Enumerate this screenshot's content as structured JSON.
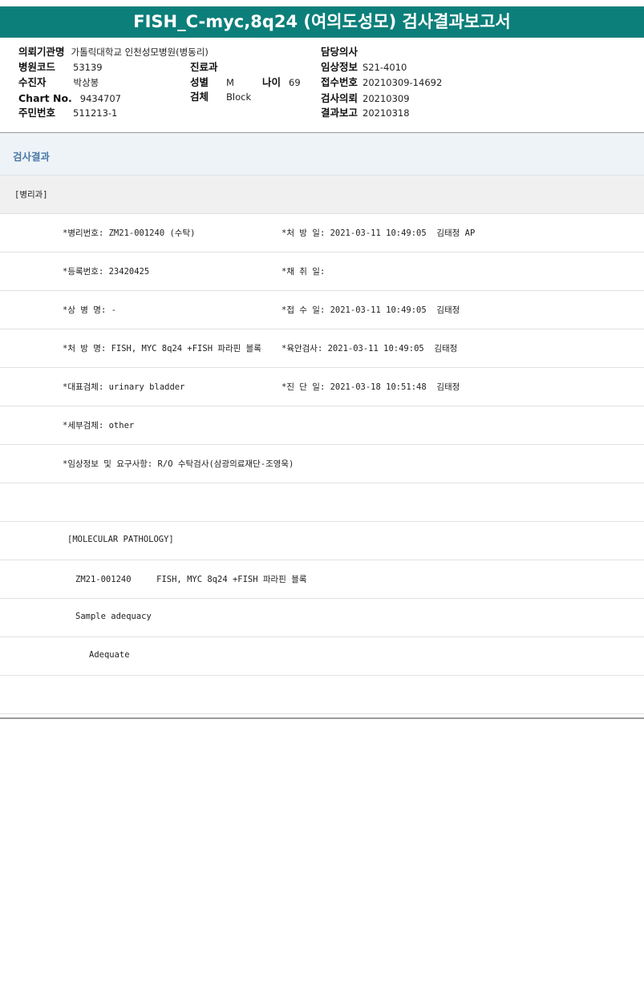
{
  "title": "FISH_C-myc,8q24 (여의도성모) 검사결과보고서",
  "info": {
    "institution_label": "의뢰기관명",
    "institution": "가톨릭대학교 인천성모병원(병동리)",
    "doctor_label": "담당의사",
    "doctor": "",
    "hospital_code_label": "병원코드",
    "hospital_code": "53139",
    "dept_label": "진료과",
    "dept": "",
    "clinical_label": "임상정보",
    "clinical": "S21-4010",
    "patient_label": "수진자",
    "patient": "박상봉",
    "sex_label": "성별",
    "sex": "M",
    "age_label": "나이",
    "age": "69",
    "receipt_label": "접수번호",
    "receipt": "20210309-14692",
    "chart_label": "Chart No.",
    "chart": "9434707",
    "specimen_label": "검체",
    "specimen": "Block",
    "request_label": "검사의뢰",
    "request": "20210309",
    "rrn_label": "주민번호",
    "rrn": "511213-1",
    "report_label": "결과보고",
    "report": "20210318"
  },
  "section_title": "검사결과",
  "rows": {
    "r0": "[병리과]",
    "r1a": "*병리번호: ZM21-001240 (수탁)",
    "r1b": "*처 방 일: 2021-03-11 10:49:05  김태정 AP",
    "r2a": "*등록번호: 23420425",
    "r2b": "*채 취 일:",
    "r3a": "*상 병 명: -",
    "r3b": "*접 수 일: 2021-03-11 10:49:05  김태정",
    "r4a": "*처 방 명: FISH, MYC 8q24 +FISH 파라핀 블록",
    "r4b": "*육안검사: 2021-03-11 10:49:05  김태정",
    "r5a": "*대표검체: urinary bladder",
    "r5b": "*진 단 일: 2021-03-18 10:51:48  김태정",
    "r6": "*세부검체: other",
    "r7": "*임상정보 및 요구사항: R/O 수탁검사(삼광의료재단-조영욱)",
    "r9": "[MOLECULAR PATHOLOGY]",
    "r10": "ZM21-001240     FISH, MYC 8q24 +FISH 파라핀 블록",
    "r11": "Sample adequacy",
    "r12": "Adequate"
  }
}
